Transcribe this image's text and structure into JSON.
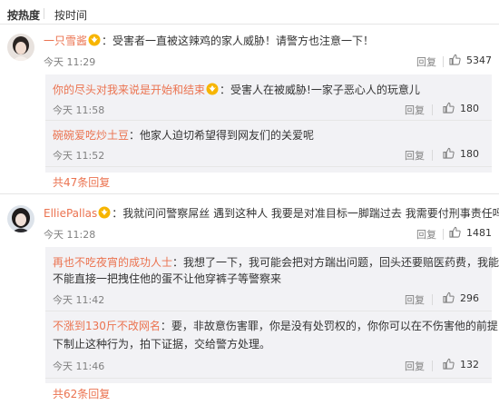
{
  "sort_bar": {
    "by_hot": "按热度",
    "by_time": "按时间"
  },
  "comments": [
    {
      "username": "一只雪酱",
      "text": "：受害者一直被这辣鸡的家人威胁！请警方也注意一下！",
      "time": "今天 11:29",
      "reply_label": "回复",
      "likes": "5347",
      "replies": [
        {
          "username": "你的尽头对我来说是开始和结束",
          "text": "：受害人在被威胁!一家子恶心人的玩意儿",
          "time": "今天 11:58",
          "reply_label": "回复",
          "likes": "180"
        },
        {
          "username": "碗碗爱吃炒土豆",
          "text": "：他家人迫切希望得到网友们的关爱呢",
          "time": "今天 11:52",
          "reply_label": "回复",
          "likes": "180"
        }
      ],
      "more_replies": "共47条回复"
    },
    {
      "username": "ElliePallas",
      "text": "：我就问问警察屌丝 遇到这种人 我要是对准目标一脚踹过去 我需要付刑事责任吗",
      "time": "今天 11:28",
      "reply_label": "回复",
      "likes": "1481",
      "replies": [
        {
          "username": "再也不吃夜宵的成功人士",
          "text_line1": "：我想了一下，我可能会把对方踹出问题，回头还要赔医药费，我能",
          "text_line2": "不能直接一把拽住他的蛋不让他穿裤子等警察来",
          "time": "今天 11:42",
          "reply_label": "回复",
          "likes": "296"
        },
        {
          "username": "不涨到130斤不改网名",
          "text_line1": "：要，非故意伤害罪，你是没有处罚权的，你你可以在不伤害他的前提",
          "text_line2": "下制止这种行为，拍下证据，交给警方处理。",
          "time": "今天 11:46",
          "reply_label": "回复",
          "likes": "132"
        }
      ],
      "more_replies": "共62条回复"
    }
  ],
  "colors": {
    "accent": "#eb7350",
    "reply_bg": "#f2f2f5",
    "meta": "#808080"
  }
}
